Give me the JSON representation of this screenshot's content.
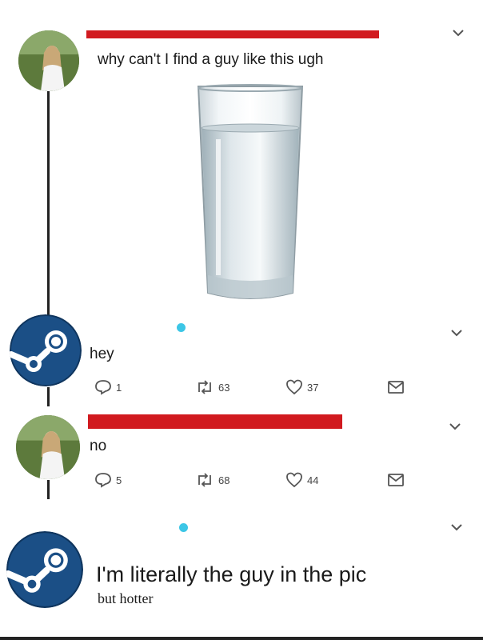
{
  "tweets": [
    {
      "id": "tweet1",
      "text": "why can't I find a guy like this ugh",
      "media": "glass-of-water-image"
    },
    {
      "id": "tweet2",
      "text": "hey",
      "actions": {
        "reply_count": "1",
        "retweet_count": "63",
        "like_count": "37"
      }
    },
    {
      "id": "tweet3",
      "text": "no",
      "actions": {
        "reply_count": "5",
        "retweet_count": "68",
        "like_count": "44"
      }
    },
    {
      "id": "tweet4",
      "text": "I'm literally the guy in the pic",
      "subtext": "but hotter"
    }
  ],
  "icons": {
    "more": "chevron-down-icon",
    "reply": "reply-icon",
    "retweet": "retweet-icon",
    "like": "heart-icon",
    "share": "share-icon",
    "steam": "steam-logo-icon"
  },
  "colors": {
    "redaction": "#d11a1f",
    "dot": "#3cc6e6"
  }
}
